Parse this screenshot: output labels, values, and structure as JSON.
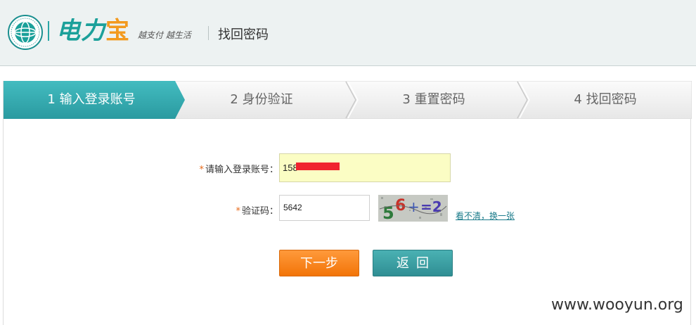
{
  "header": {
    "brand_part1": "电力",
    "brand_part2": "宝",
    "slogan": "越支付 越生活",
    "page_title": "找回密码"
  },
  "steps": [
    {
      "label": "1 输入登录账号",
      "active": true
    },
    {
      "label": "2 身份验证",
      "active": false
    },
    {
      "label": "3 重置密码",
      "active": false
    },
    {
      "label": "4 找回密码",
      "active": false
    }
  ],
  "form": {
    "account_label": "请输入登录账号：",
    "account_value": "158",
    "code_label": "验证码：",
    "code_value": "5642",
    "captcha_text": "56+2",
    "refresh_link": "看不清，换一张",
    "required_mark": "*"
  },
  "buttons": {
    "next": "下一步",
    "back": "返回"
  },
  "watermark": "www.wooyun.org",
  "colors": {
    "accent_teal": "#2fa7ab",
    "accent_orange": "#f27408",
    "input_highlight": "#fbfdc4"
  }
}
